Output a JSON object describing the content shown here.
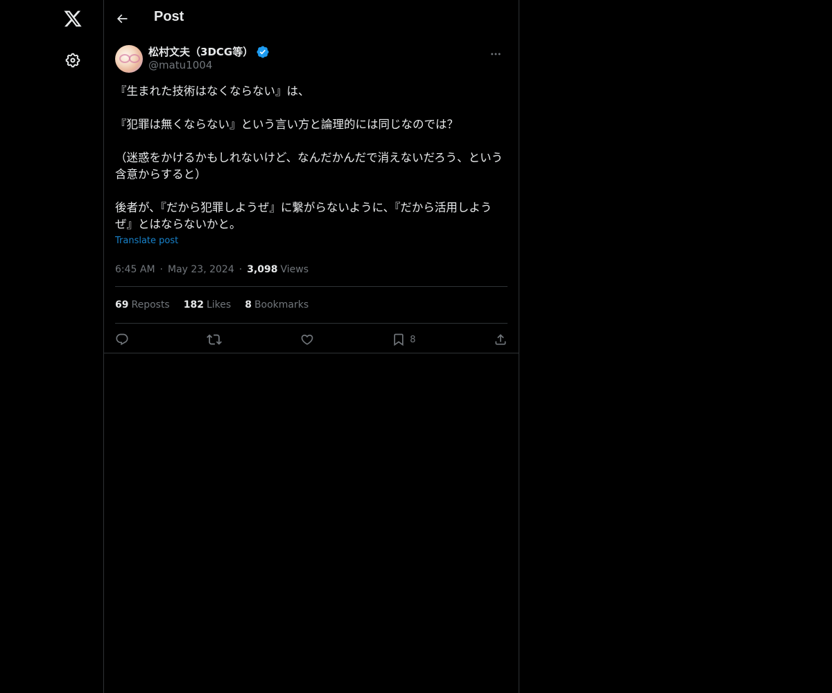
{
  "nav": {
    "logo_icon": "x-logo-icon",
    "settings_icon": "gear-icon"
  },
  "header": {
    "back_icon": "arrow-left-icon",
    "title": "Post"
  },
  "post": {
    "author": {
      "display_name": "松村文夫（3DCG等）",
      "handle": "@matu1004",
      "verified": true,
      "verified_color": "#1d9bf0"
    },
    "more_icon": "more-horizontal-icon",
    "text": "『生まれた技術はなくならない』は、\n\n『犯罪は無くならない』という言い方と論理的には同じなのでは？\n\n（迷惑をかけるかもしれないけど、なんだかんだで消えないだろう、という含意からすると）\n\n後者が、『だから犯罪しようぜ』に繋がらないように、『だから活用しようぜ』とはならないかと。",
    "translate_label": "Translate post",
    "time": "6:45 AM",
    "date": "May 23, 2024",
    "views_count": "3,098",
    "views_label": "Views",
    "stats": {
      "reposts_count": "69",
      "reposts_label": "Reposts",
      "likes_count": "182",
      "likes_label": "Likes",
      "bookmarks_count": "8",
      "bookmarks_label": "Bookmarks"
    },
    "actions": {
      "reply_icon": "reply-icon",
      "repost_icon": "repost-icon",
      "like_icon": "heart-icon",
      "bookmark_icon": "bookmark-icon",
      "bookmark_count": "8",
      "share_icon": "share-icon"
    }
  },
  "colors": {
    "background": "#000000",
    "text": "#e7e9ea",
    "secondary_text": "#71767b",
    "border": "#2f3336",
    "accent": "#1d9bf0"
  }
}
